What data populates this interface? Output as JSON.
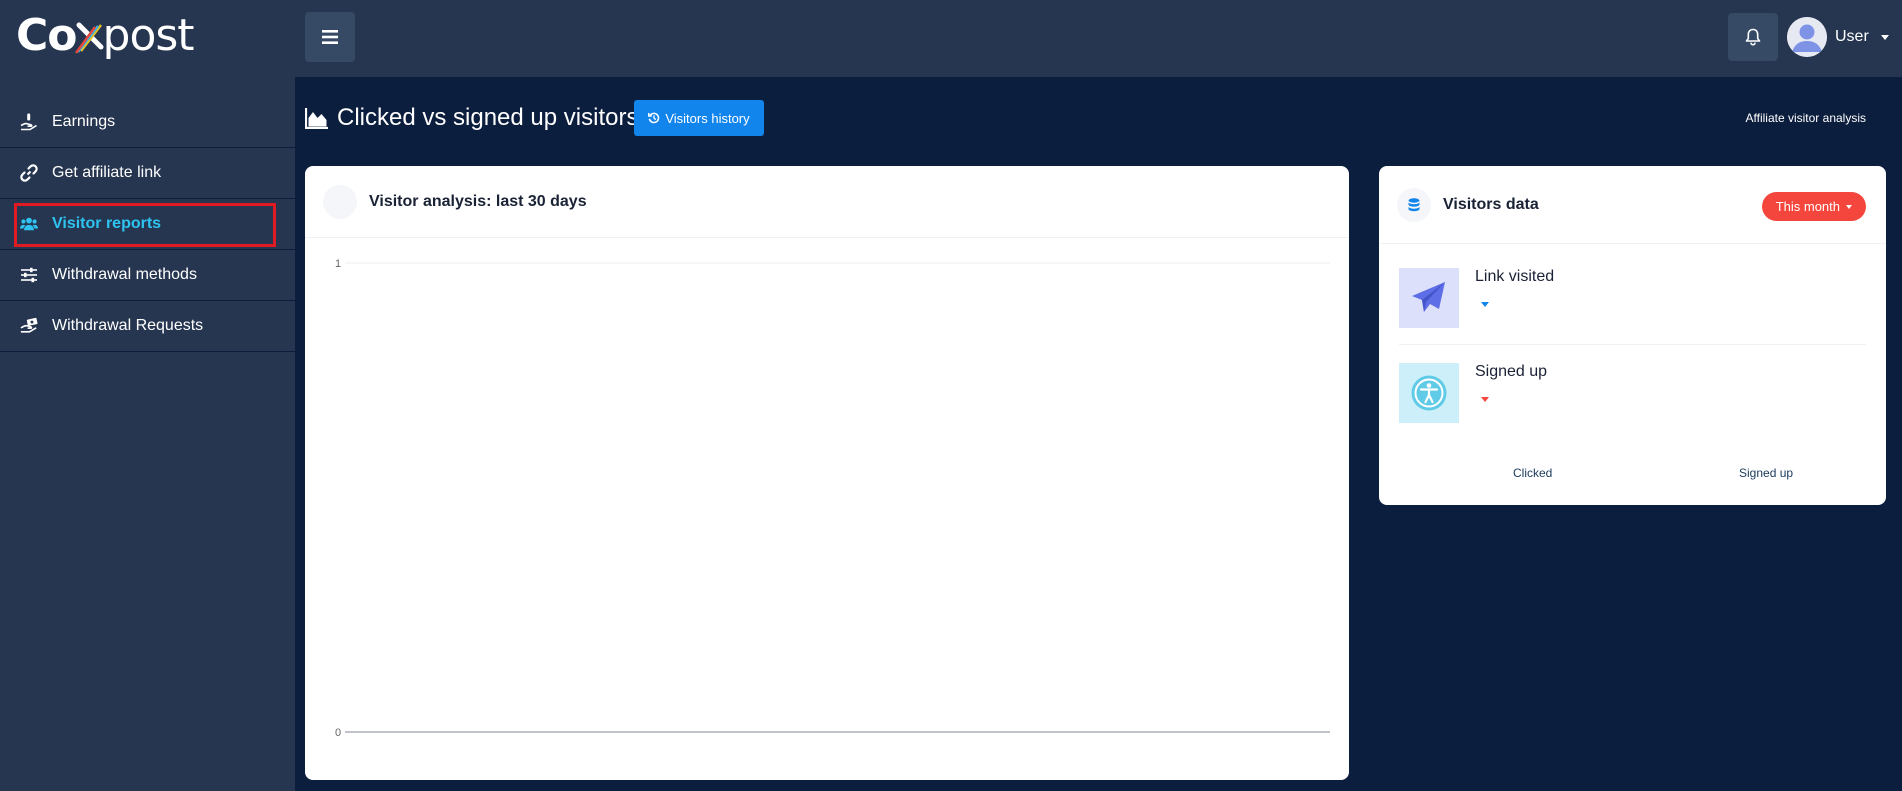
{
  "brand": {
    "logo_left": "Co",
    "logo_right": "post"
  },
  "topbar": {
    "user_name": "User"
  },
  "sidebar": {
    "items": [
      {
        "label": "Earnings",
        "icon": "hand-holding-dollar-icon"
      },
      {
        "label": "Get affiliate link",
        "icon": "link-icon"
      },
      {
        "label": "Visitor reports",
        "icon": "users-icon",
        "active": true
      },
      {
        "label": "Withdrawal methods",
        "icon": "sliders-icon"
      },
      {
        "label": "Withdrawal Requests",
        "icon": "hand-holding-money-icon"
      }
    ]
  },
  "page": {
    "title": "Clicked vs signed up visitors",
    "history_button": "Visitors history",
    "breadcrumb": "Affiliate visitor analysis"
  },
  "chart_card": {
    "title": "Visitor analysis: last 30 days"
  },
  "chart_data": {
    "type": "line",
    "title": "",
    "xlabel": "",
    "ylabel": "",
    "ylim": [
      0,
      1
    ],
    "yticks": [
      "1",
      "0"
    ],
    "series": []
  },
  "visitors_card": {
    "title": "Visitors data",
    "period_button": "This month",
    "stats": [
      {
        "label": "Link visited",
        "icon": "paper-plane-icon",
        "trend_color": "#1185ec"
      },
      {
        "label": "Signed up",
        "icon": "accessibility-icon",
        "trend_color": "#f5463d"
      }
    ],
    "legend": [
      "Clicked",
      "Signed up"
    ]
  },
  "colors": {
    "background": "#0c1e3e",
    "panel": "#263650",
    "accent": "#1185ec",
    "active_nav": "#2ec3f0",
    "danger": "#f5463d"
  }
}
